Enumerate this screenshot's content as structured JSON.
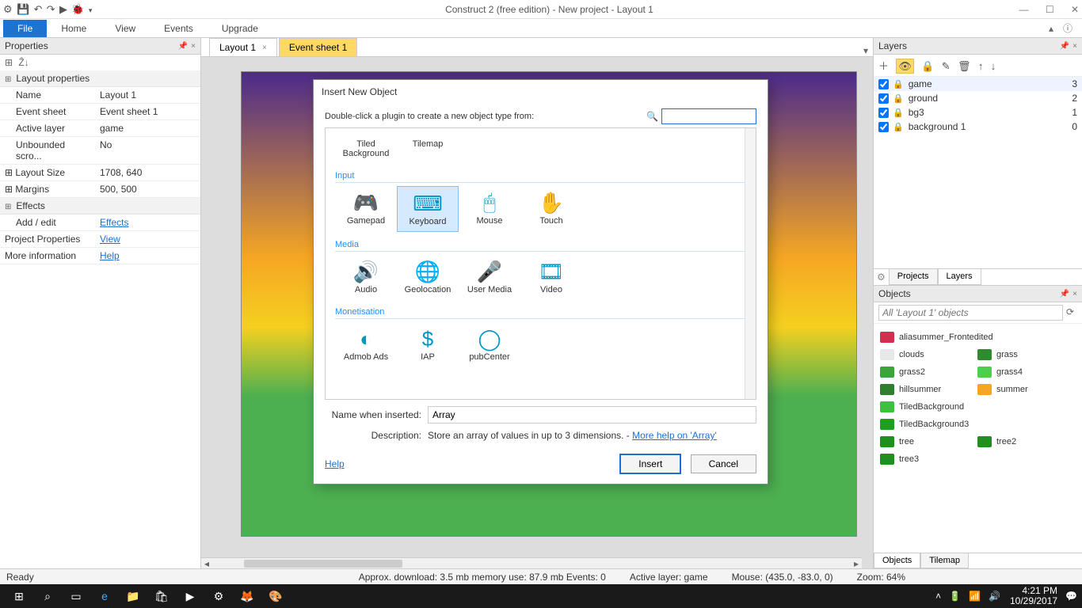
{
  "titlebar": {
    "title": "Construct 2  (free edition) - New project - Layout 1"
  },
  "ribbon": {
    "file": "File",
    "home": "Home",
    "view": "View",
    "events": "Events",
    "upgrade": "Upgrade"
  },
  "props": {
    "panel_title": "Properties",
    "section": "Layout properties",
    "rows": [
      {
        "k": "Name",
        "v": "Layout 1"
      },
      {
        "k": "Event sheet",
        "v": "Event sheet 1"
      },
      {
        "k": "Active layer",
        "v": "game"
      },
      {
        "k": "Unbounded scro...",
        "v": "No"
      },
      {
        "k": "Layout Size",
        "v": "1708, 640"
      },
      {
        "k": "Margins",
        "v": "500, 500"
      }
    ],
    "effects_section": "Effects",
    "add_edit": "Add / edit",
    "effects_link": "Effects",
    "proj_props": "Project Properties",
    "view_link": "View",
    "more_info": "More information",
    "help_link": "Help"
  },
  "tabs": {
    "layout": "Layout 1",
    "eventsheet": "Event sheet 1"
  },
  "layers": {
    "panel_title": "Layers",
    "items": [
      {
        "name": "game",
        "idx": "3"
      },
      {
        "name": "ground",
        "idx": "2"
      },
      {
        "name": "bg3",
        "idx": "1"
      },
      {
        "name": "background 1",
        "idx": "0"
      }
    ],
    "right_tabs": {
      "projects": "Projects",
      "layers": "Layers"
    }
  },
  "objects": {
    "panel_title": "Objects",
    "search_placeholder": "All 'Layout 1' objects",
    "items": [
      {
        "label": "aliasummer_Frontedited",
        "color": "#d03050",
        "full": true
      },
      {
        "label": "clouds",
        "color": "#e8e8e8"
      },
      {
        "label": "grass",
        "color": "#2e8b2e"
      },
      {
        "label": "grass2",
        "color": "#3aa63a"
      },
      {
        "label": "grass4",
        "color": "#4cd04c"
      },
      {
        "label": "hillsummer",
        "color": "#2f7f2f"
      },
      {
        "label": "summer",
        "color": "#f5a623"
      },
      {
        "label": "TiledBackground",
        "color": "#3cc13c",
        "full": true
      },
      {
        "label": "TiledBackground3",
        "color": "#1f9f1f",
        "full": true
      },
      {
        "label": "tree",
        "color": "#1f8f1f"
      },
      {
        "label": "tree2",
        "color": "#1f8f1f"
      },
      {
        "label": "tree3",
        "color": "#1f8f1f"
      }
    ],
    "bottom_tabs": {
      "objects": "Objects",
      "tilemap": "Tilemap"
    }
  },
  "dialog": {
    "title": "Insert New Object",
    "hint": "Double-click a plugin to create a new object type from:",
    "top_items": [
      {
        "label": "Tiled Background"
      },
      {
        "label": "Tilemap"
      }
    ],
    "cats": [
      {
        "name": "Input",
        "items": [
          {
            "label": "Gamepad",
            "icon": "🎮"
          },
          {
            "label": "Keyboard",
            "icon": "⌨",
            "selected": true
          },
          {
            "label": "Mouse",
            "icon": "🖱"
          },
          {
            "label": "Touch",
            "icon": "✋"
          }
        ]
      },
      {
        "name": "Media",
        "items": [
          {
            "label": "Audio",
            "icon": "🔊"
          },
          {
            "label": "Geolocation",
            "icon": "🌐"
          },
          {
            "label": "User Media",
            "icon": "🎤"
          },
          {
            "label": "Video",
            "icon": "🎞"
          }
        ]
      },
      {
        "name": "Monetisation",
        "items": [
          {
            "label": "Admob Ads",
            "icon": "◐"
          },
          {
            "label": "IAP",
            "icon": "$"
          },
          {
            "label": "pubCenter",
            "icon": "◯"
          }
        ]
      }
    ],
    "name_label": "Name when inserted:",
    "name_value": "Array",
    "desc_label": "Description:",
    "desc_text": "Store an array of values in up to 3 dimensions. - ",
    "desc_link": "More help on 'Array'",
    "help": "Help",
    "insert": "Insert",
    "cancel": "Cancel"
  },
  "status": {
    "ready": "Ready",
    "approx": "Approx. download: 3.5 mb   memory use: 87.9 mb   Events: 0",
    "active": "Active layer: game",
    "mouse": "Mouse: (435.0, -83.0, 0)",
    "zoom": "Zoom: 64%"
  },
  "taskbar": {
    "time": "4:21 PM",
    "date": "10/29/2017"
  }
}
